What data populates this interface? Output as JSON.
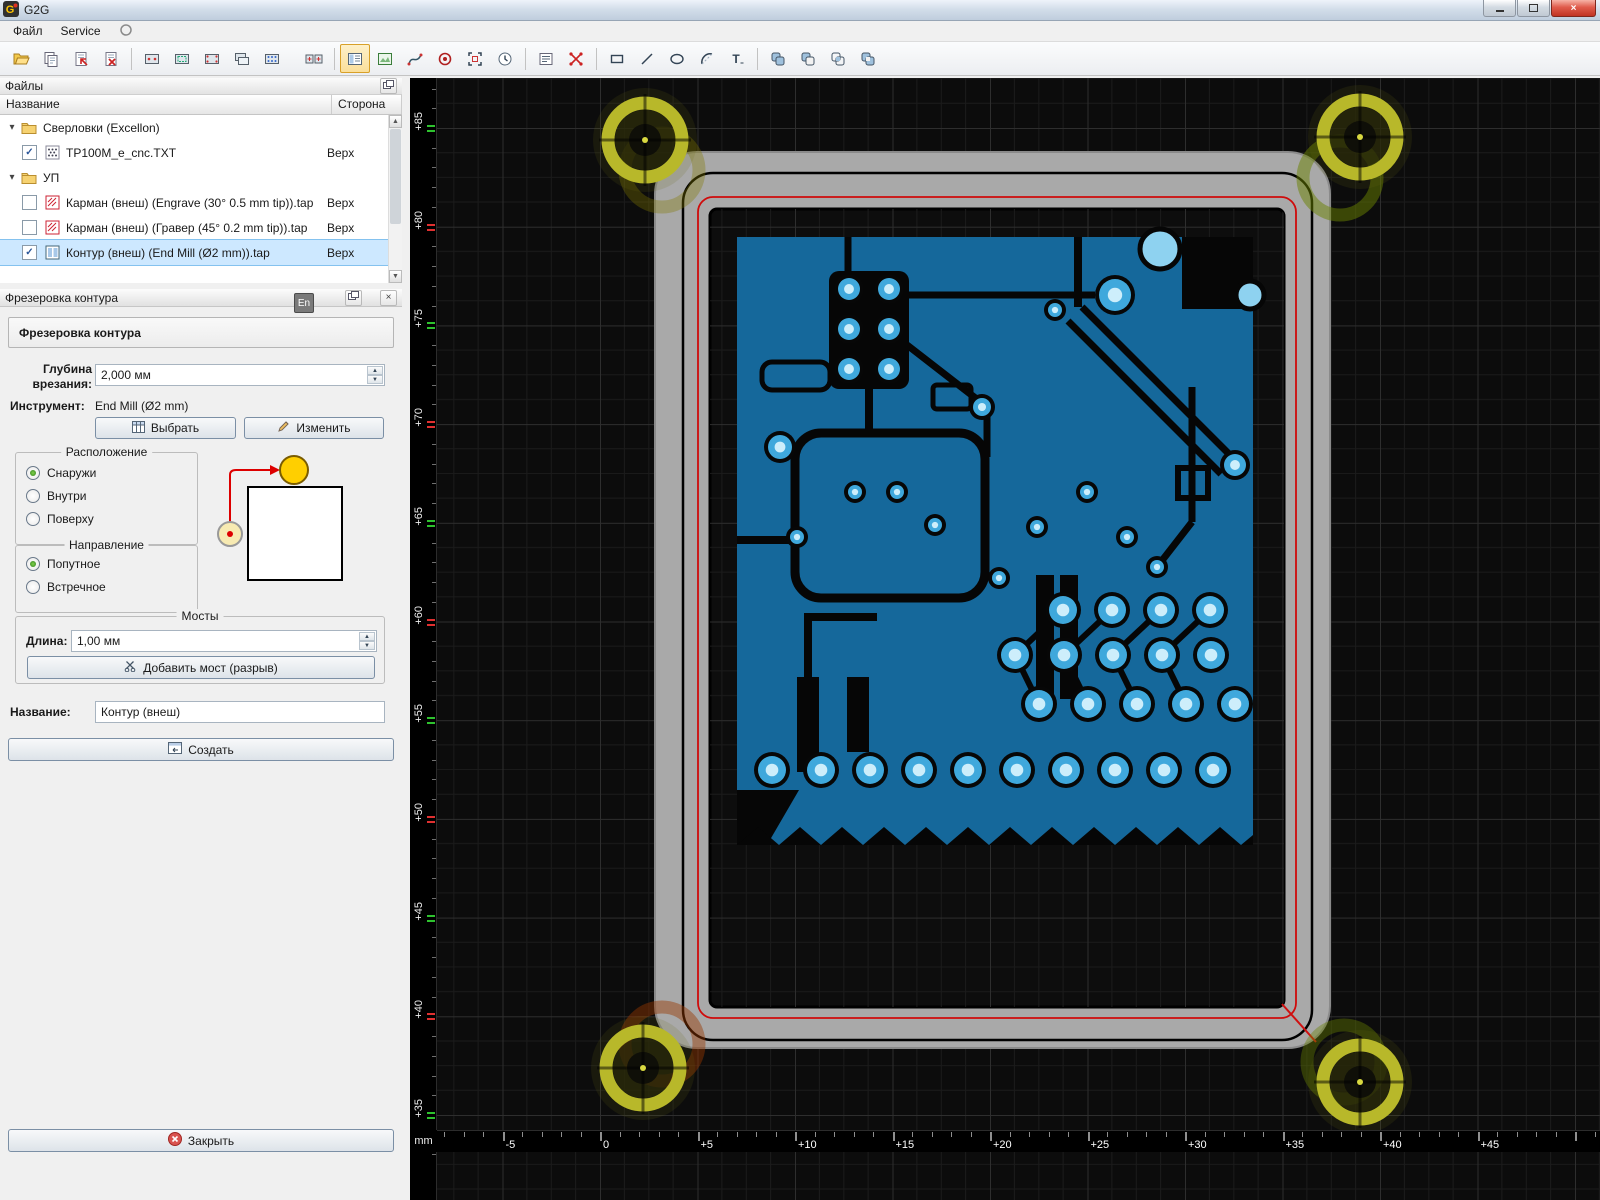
{
  "window": {
    "title": "G2G"
  },
  "menubar": {
    "items": [
      {
        "id": "file",
        "label": "Файл"
      },
      {
        "id": "service",
        "label": "Service"
      },
      {
        "id": "settings",
        "label": "",
        "icon": "circle-icon"
      }
    ]
  },
  "toolbar": {
    "items": [
      {
        "name": "open",
        "icon": "open-icon"
      },
      {
        "name": "save-copy",
        "icon": "copy-icon"
      },
      {
        "name": "import",
        "icon": "import-icon"
      },
      {
        "name": "remove",
        "icon": "remove-icon"
      },
      {
        "sep": true
      },
      {
        "name": "board-new",
        "icon": "board-new-icon"
      },
      {
        "name": "board-select",
        "icon": "board-select-icon"
      },
      {
        "name": "board-marks",
        "icon": "board-marks-icon"
      },
      {
        "name": "board-copy",
        "icon": "board-copy-icon"
      },
      {
        "name": "board-array",
        "icon": "board-array-icon"
      },
      {
        "gap": true
      },
      {
        "name": "panelize",
        "icon": "panelize-icon"
      },
      {
        "sep": true
      },
      {
        "name": "files-view",
        "icon": "files-view-icon",
        "active": true
      },
      {
        "name": "preview-view",
        "icon": "preview-view-icon"
      },
      {
        "name": "toolpath-edit",
        "icon": "curve-icon"
      },
      {
        "name": "drill-marks",
        "icon": "target-icon"
      },
      {
        "name": "fit-view",
        "icon": "fit-icon"
      },
      {
        "name": "simulation",
        "icon": "clock-icon"
      },
      {
        "sep": true
      },
      {
        "name": "properties",
        "icon": "list-icon"
      },
      {
        "name": "junctions",
        "icon": "junction-icon"
      },
      {
        "sep": true
      },
      {
        "name": "draw-rect",
        "icon": "rect-icon"
      },
      {
        "name": "draw-line",
        "icon": "line-icon"
      },
      {
        "name": "draw-ellipse",
        "icon": "ellipse-icon"
      },
      {
        "name": "draw-arc",
        "icon": "arc-icon"
      },
      {
        "name": "draw-text",
        "icon": "text-icon"
      },
      {
        "sep": true
      },
      {
        "name": "poly-union",
        "icon": "poly-union-icon"
      },
      {
        "name": "poly-subtract",
        "icon": "poly-subtract-icon"
      },
      {
        "name": "poly-intersect",
        "icon": "poly-intersect-icon"
      },
      {
        "name": "poly-exclude",
        "icon": "poly-exclude-icon"
      }
    ]
  },
  "files_panel": {
    "title": "Файлы",
    "columns": [
      "Название",
      "Сторона"
    ],
    "rows": [
      {
        "kind": "folder",
        "label": "Сверловки (Excellon)"
      },
      {
        "kind": "file",
        "icon": "drill-file-icon",
        "label": "TP100M_e_cnc.TXT",
        "side": "Верх",
        "checked": true
      },
      {
        "kind": "folder",
        "label": "УП"
      },
      {
        "kind": "file",
        "icon": "engrave-file-icon",
        "label": "Карман (внеш) (Engrave (30° 0.5 mm tip)).tap",
        "side": "Верх",
        "checked": false
      },
      {
        "kind": "file",
        "icon": "engrave-file-icon",
        "label": "Карман (внеш) (Гравер (45° 0.2 mm tip)).tap",
        "side": "Верх",
        "checked": false
      },
      {
        "kind": "file",
        "icon": "contour-file-icon",
        "label": "Контур (внеш) (End Mill (Ø2 mm)).tap",
        "side": "Верх",
        "checked": true,
        "selected": true
      }
    ]
  },
  "contour_dialog": {
    "title": "Фрезеровка контура",
    "lang_badge": "En",
    "section_title": "Фрезеровка контура",
    "depth_label": "Глубина врезания:",
    "depth_value": "2,000 мм",
    "tool_label": "Инструмент:",
    "tool_value": "End Mill (Ø2 mm)",
    "select_button": "Выбрать",
    "change_button": "Изменить",
    "location": {
      "title": "Расположение",
      "options": [
        "Снаружи",
        "Внутри",
        "Поверху"
      ],
      "selected": "Снаружи"
    },
    "direction": {
      "title": "Направление",
      "options": [
        "Попутное",
        "Встречное"
      ],
      "selected": "Попутное"
    },
    "bridges": {
      "title": "Мосты",
      "length_label": "Длина:",
      "length_value": "1,00 мм",
      "add_button": "Добавить мост (разрыв)"
    },
    "name_label": "Название:",
    "name_value": "Контур (внеш)",
    "create_button": "Создать",
    "close_button": "Закрыть"
  },
  "canvas": {
    "unit": "mm",
    "v_ruler": [
      {
        "label": "+85",
        "value": 85
      },
      {
        "label": "+80",
        "value": 80
      },
      {
        "label": "+75",
        "value": 75
      },
      {
        "label": "+70",
        "value": 70
      },
      {
        "label": "+65",
        "value": 65
      },
      {
        "label": "+60",
        "value": 60
      },
      {
        "label": "+55",
        "value": 55
      },
      {
        "label": "+50",
        "value": 50
      },
      {
        "label": "+45",
        "value": 45
      },
      {
        "label": "+40",
        "value": 40
      },
      {
        "label": "+35",
        "value": 35
      }
    ],
    "h_ruler": [
      {
        "label": "-5",
        "value": -5
      },
      {
        "label": "0",
        "value": 0
      },
      {
        "label": "+5",
        "value": 5
      },
      {
        "label": "+10",
        "value": 10
      },
      {
        "label": "+15",
        "value": 15
      },
      {
        "label": "+20",
        "value": 20
      },
      {
        "label": "+25",
        "value": 25
      },
      {
        "label": "+30",
        "value": 30
      },
      {
        "label": "+35",
        "value": 35
      },
      {
        "label": "+40",
        "value": 40
      },
      {
        "label": "+45",
        "value": 45
      }
    ]
  },
  "colors": {
    "selection": "#cde8ff",
    "toolbar_active": "#fbdf9a",
    "contour_red": "#cf0b0b",
    "pcb_blue": "#15689b",
    "pad_light": "#cdeefb",
    "fiducial_yellow": "#b8b82a",
    "ruler_green": "#2ec22e",
    "ruler_red": "#e03030"
  }
}
